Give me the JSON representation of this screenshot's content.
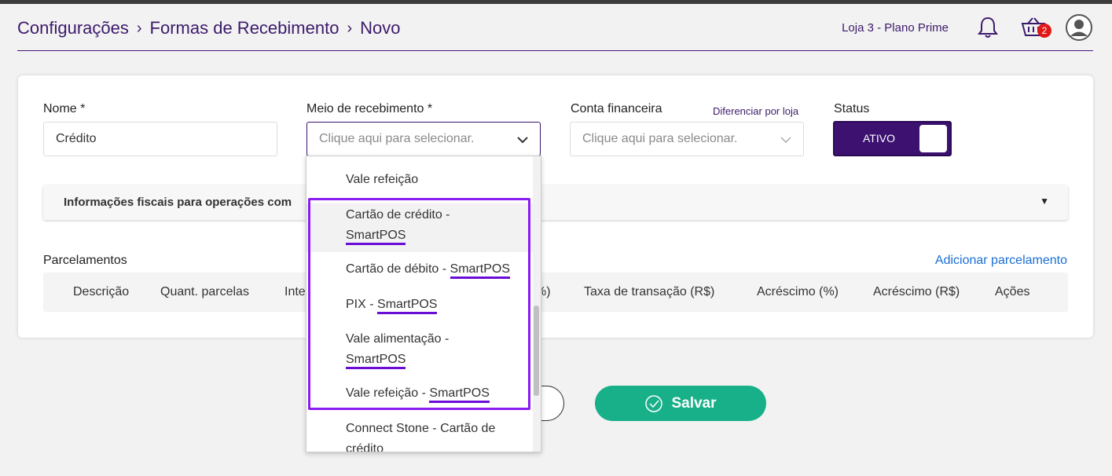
{
  "breadcrumb": {
    "item1": "Configurações",
    "item2": "Formas de Recebimento",
    "item3": "Novo",
    "separator": "›"
  },
  "header": {
    "store": "Loja 3 - Plano Prime",
    "cart_count": "2"
  },
  "form": {
    "nome_label": "Nome *",
    "nome_value": "Crédito",
    "meio_label": "Meio de recebimento *",
    "meio_placeholder": "Clique aqui para selecionar.",
    "conta_label": "Conta financeira",
    "conta_placeholder": "Clique aqui para selecionar.",
    "diferenciar_link": "Diferenciar por loja",
    "status_label": "Status",
    "status_value": "ATIVO"
  },
  "fiscal": {
    "title": "Informações fiscais para operações com",
    "caret": "▼"
  },
  "parcelamentos": {
    "title": "Parcelamentos",
    "add_link": "Adicionar parcelamento",
    "columns": [
      "Descrição",
      "Quant. parcelas",
      "Inte",
      "%)",
      "Taxa de transação (R$)",
      "Acréscimo (%)",
      "Acréscimo (R$)",
      "Ações"
    ]
  },
  "buttons": {
    "save": "Salvar"
  },
  "dropdown": {
    "options": [
      {
        "main": "Vale refeição",
        "tag": ""
      },
      {
        "main": "Cartão de crédito -",
        "tag": "SmartPOS"
      },
      {
        "main": "Cartão de débito - ",
        "tag": "SmartPOS"
      },
      {
        "main": "PIX - ",
        "tag": "SmartPOS"
      },
      {
        "main": "Vale alimentação -",
        "tag": "SmartPOS"
      },
      {
        "main": "Vale refeição - ",
        "tag": "SmartPOS"
      },
      {
        "main": "Connect Stone - Cartão de",
        "tag": "crédito"
      }
    ]
  },
  "colors": {
    "brand": "#3c1170",
    "accent": "#8a1cf2",
    "save": "#18b088",
    "link": "#1a6fd4"
  }
}
